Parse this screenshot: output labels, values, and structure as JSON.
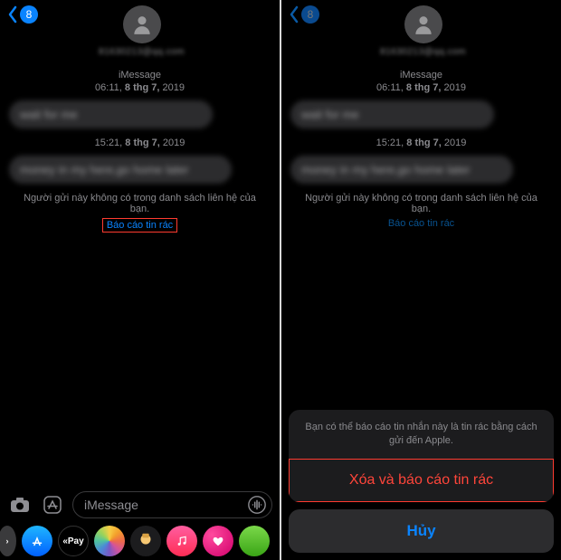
{
  "left": {
    "unread": "8",
    "contact": "81630213@qq.com",
    "service": "iMessage",
    "ts1_time": "06:11,",
    "ts1_date": "8 thg 7,",
    "ts1_year": "2019",
    "msg1": "wait for me",
    "ts2_time": "15:21,",
    "ts2_date": "8 thg 7,",
    "ts2_year": "2019",
    "msg2": "money in my here,go home later",
    "notice": "Người gửi này không có trong danh sách liên hệ của bạn.",
    "report": "Báo cáo tin rác",
    "input_placeholder": "iMessage",
    "apps": {
      "store": "A",
      "pay": "«Pay",
      "photos": "",
      "memoji": "",
      "music": "",
      "digital": "",
      "more": ""
    }
  },
  "right": {
    "unread": "8",
    "contact": "81630213@qq.com",
    "service": "iMessage",
    "ts1_time": "06:11,",
    "ts1_date": "8 thg 7,",
    "ts1_year": "2019",
    "msg1": "wait for me",
    "ts2_time": "15:21,",
    "ts2_date": "8 thg 7,",
    "ts2_year": "2019",
    "msg2": "money in my here,go home later",
    "notice": "Người gửi này không có trong danh sách liên hệ của bạn.",
    "report": "Báo cáo tin rác",
    "sheet_msg": "Bạn có thể báo cáo tin nhắn này là tin rác bằng cách gửi đến Apple.",
    "sheet_destructive": "Xóa và báo cáo tin rác",
    "sheet_cancel": "Hủy"
  }
}
